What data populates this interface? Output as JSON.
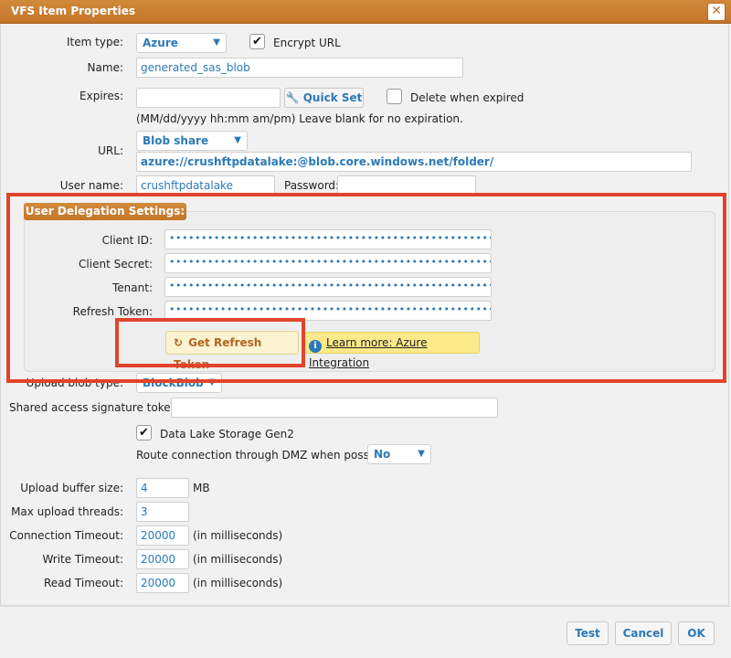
{
  "window": {
    "title": "VFS Item Properties",
    "close_glyph": "✕"
  },
  "item_type": {
    "label": "Item type:",
    "value": "Azure"
  },
  "encrypt_url": {
    "label": "Encrypt URL",
    "checked": true
  },
  "name": {
    "label": "Name:",
    "value": "generated_sas_blob"
  },
  "expires": {
    "label": "Expires:",
    "value": "",
    "quick_set_label": "Quick Set",
    "delete_label": "Delete when expired",
    "hint": "(MM/dd/yyyy hh:mm am/pm) Leave blank for no expiration."
  },
  "url": {
    "label": "URL:",
    "type_value": "Blob share",
    "value": "azure://crushftpdatalake:@blob.core.windows.net/folder/"
  },
  "user_name": {
    "label": "User name:",
    "value": "crushftpdatalake"
  },
  "password": {
    "label": "Password:",
    "value": ""
  },
  "delegation": {
    "legend": "User Delegation Settings:",
    "client_id": {
      "label": "Client ID:",
      "value": "••••••••••••••••••••••••••••••••••••••••••••••••••••••••••"
    },
    "client_secret": {
      "label": "Client Secret:",
      "value": "••••••••••••••••••••••••••••••••••••••••••••••••••••••••••"
    },
    "tenant": {
      "label": "Tenant:",
      "value": "••••••••••••••••••••••••••••••••••••••••••••••••••••••••••"
    },
    "refresh_token": {
      "label": "Refresh Token:",
      "value": "••••••••••••••••••••••••••••••••••••••••••••••••••••••••••"
    },
    "get_token_label": "Get Refresh Token",
    "learn_more_label": "Learn more: Azure Integration",
    "info_glyph": "i"
  },
  "upload_blob_type": {
    "label": "Upload blob type:",
    "value": "BlockBlob"
  },
  "sas_token": {
    "label": "Shared access signature token:",
    "value": ""
  },
  "data_lake": {
    "label": "Data Lake Storage Gen2",
    "checked": true
  },
  "dmz": {
    "label": "Route connection through DMZ when possible:",
    "value": "No"
  },
  "upload_buffer": {
    "label": "Upload buffer size:",
    "value": "4",
    "unit": "MB"
  },
  "max_threads": {
    "label": "Max upload threads:",
    "value": "3"
  },
  "conn_timeout": {
    "label": "Connection Timeout:",
    "value": "20000",
    "unit": "(in milliseconds)"
  },
  "write_timeout": {
    "label": "Write Timeout:",
    "value": "20000",
    "unit": "(in milliseconds)"
  },
  "read_timeout": {
    "label": "Read Timeout:",
    "value": "20000",
    "unit": "(in milliseconds)"
  },
  "footer": {
    "test_label": "Test",
    "cancel_label": "Cancel",
    "ok_label": "OK"
  },
  "colors": {
    "accent": "#c47529",
    "link": "#2a7ab8",
    "highlight": "#e2432c"
  },
  "icons": {
    "wrench": "wrench-icon",
    "refresh": "refresh-icon",
    "info": "info-icon",
    "check": "checkmark-icon",
    "chevron": "chevron-down-icon"
  }
}
